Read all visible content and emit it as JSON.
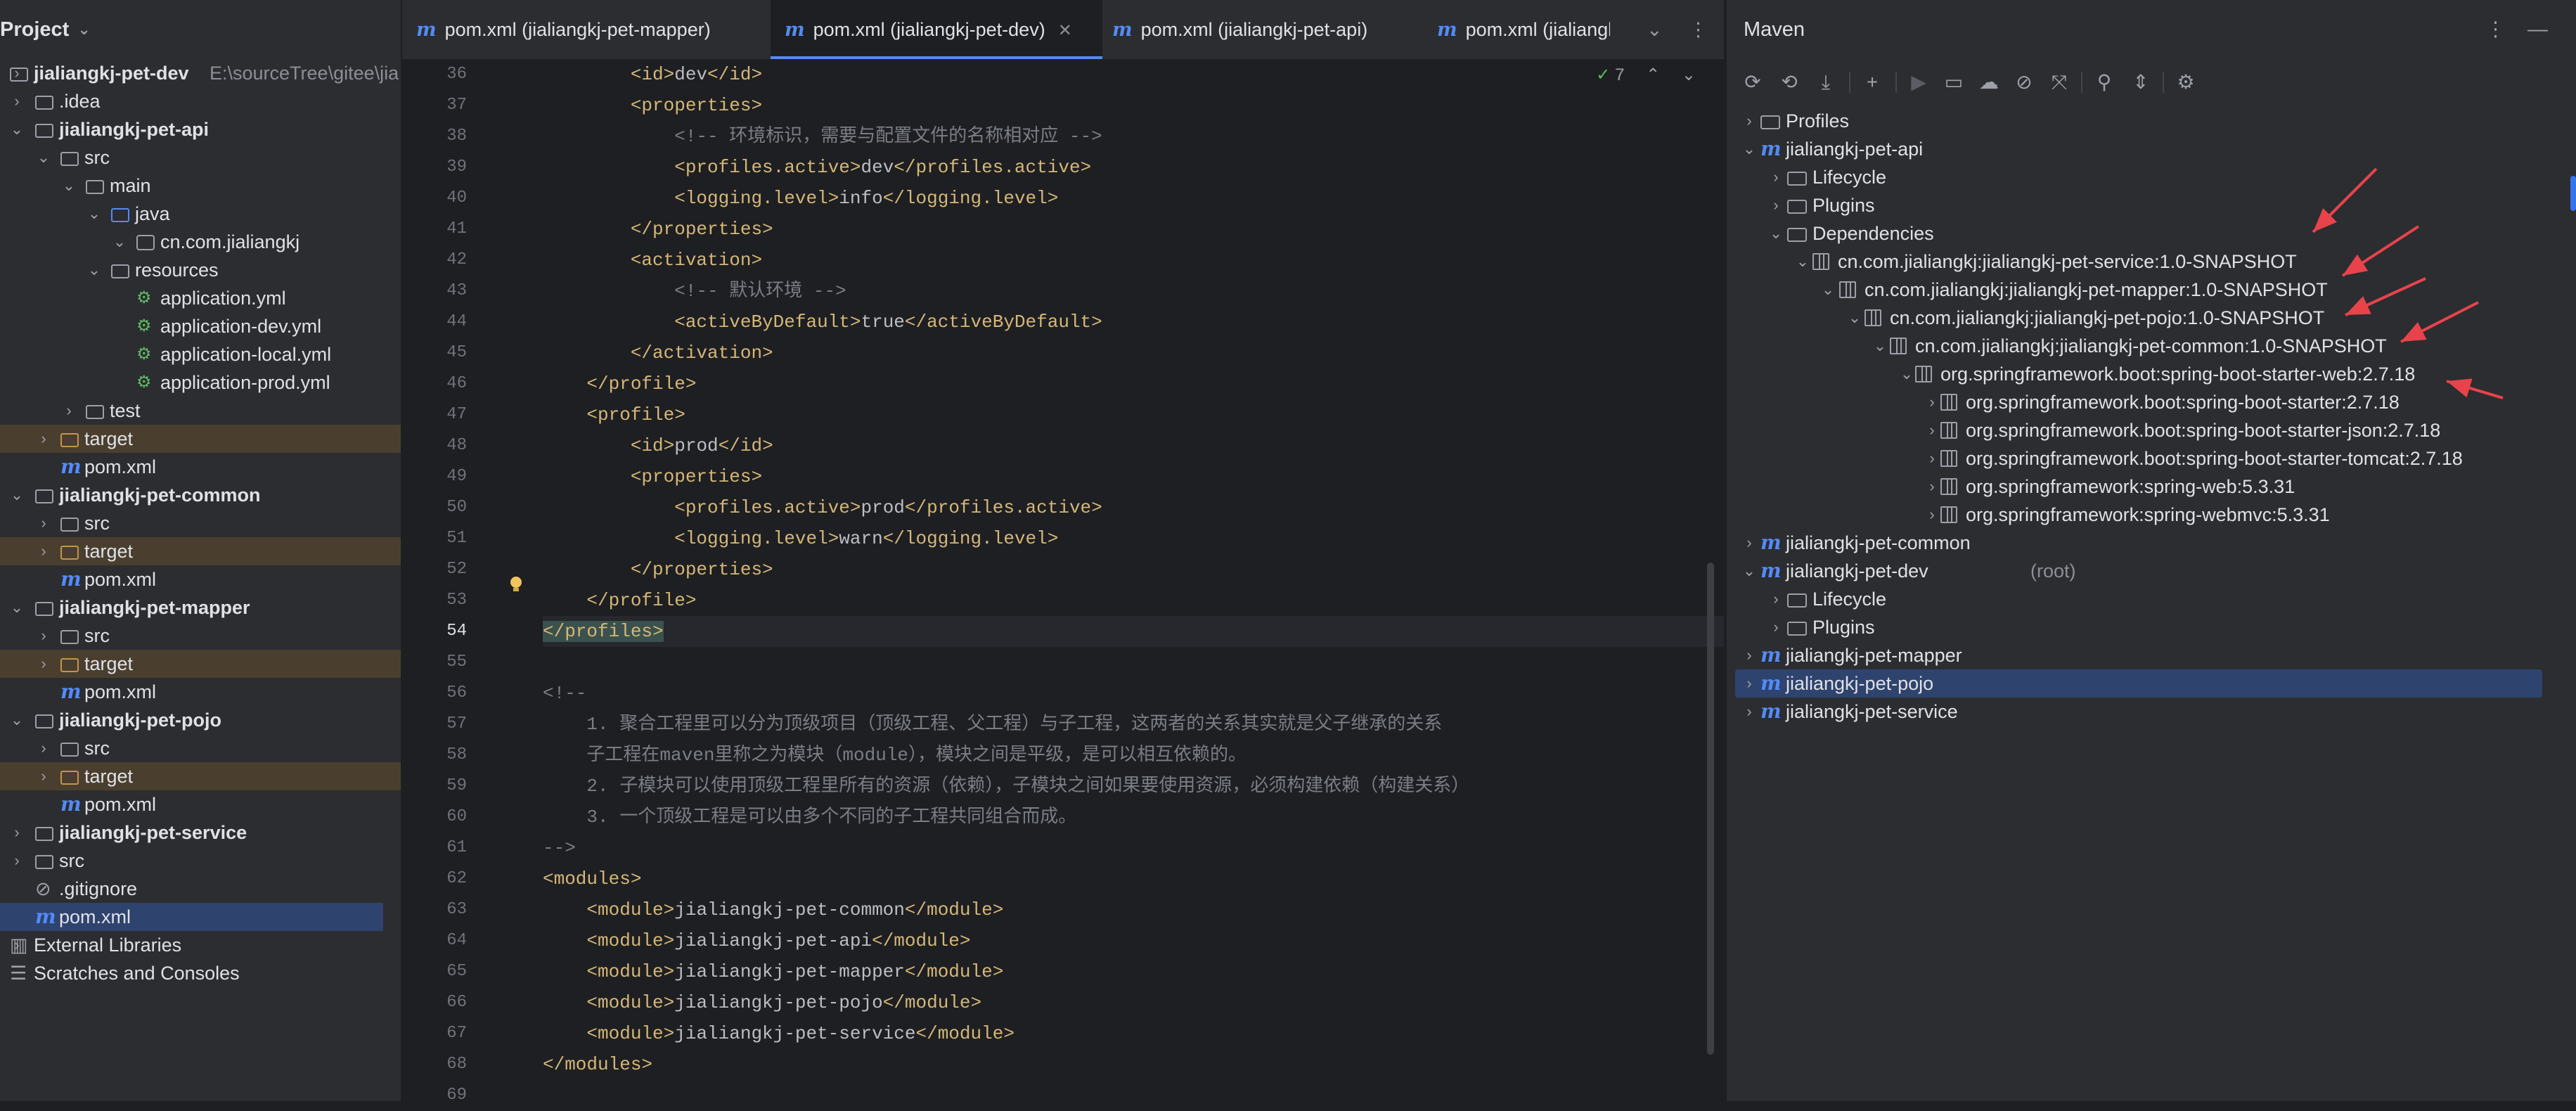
{
  "project": {
    "title": "Project",
    "items": [
      {
        "label": "jialiangkj-pet-dev",
        "path": "E:\\sourceTree\\gitee\\jia"
      },
      {
        "label": ".idea"
      },
      {
        "label": "jialiangkj-pet-api"
      },
      {
        "label": "src"
      },
      {
        "label": "main"
      },
      {
        "label": "java"
      },
      {
        "label": "cn.com.jialiangkj"
      },
      {
        "label": "resources"
      },
      {
        "label": "application.yml"
      },
      {
        "label": "application-dev.yml"
      },
      {
        "label": "application-local.yml"
      },
      {
        "label": "application-prod.yml"
      },
      {
        "label": "test"
      },
      {
        "label": "target"
      },
      {
        "label": "pom.xml"
      },
      {
        "label": "jialiangkj-pet-common"
      },
      {
        "label": "src"
      },
      {
        "label": "target"
      },
      {
        "label": "pom.xml"
      },
      {
        "label": "jialiangkj-pet-mapper"
      },
      {
        "label": "src"
      },
      {
        "label": "target"
      },
      {
        "label": "pom.xml"
      },
      {
        "label": "jialiangkj-pet-pojo"
      },
      {
        "label": "src"
      },
      {
        "label": "target"
      },
      {
        "label": "pom.xml"
      },
      {
        "label": "jialiangkj-pet-service"
      },
      {
        "label": "src"
      },
      {
        "label": ".gitignore"
      },
      {
        "label": "pom.xml"
      },
      {
        "label": "External Libraries"
      },
      {
        "label": "Scratches and Consoles"
      }
    ]
  },
  "editor": {
    "tabs": [
      {
        "label": "pom.xml (jialiangkj-pet-mapper)"
      },
      {
        "label": "pom.xml (jialiangkj-pet-dev)"
      },
      {
        "label": "pom.xml (jialiangkj-pet-api)"
      },
      {
        "label": "pom.xml (jialiangkj"
      }
    ],
    "inspection_count": "7",
    "lines": [
      {
        "n": "36",
        "segs": [
          [
            "t",
            "        <id>"
          ],
          [
            "tx",
            "dev"
          ],
          [
            "t",
            "</id>"
          ]
        ]
      },
      {
        "n": "37",
        "segs": [
          [
            "t",
            "        <properties>"
          ]
        ]
      },
      {
        "n": "38",
        "segs": [
          [
            "cm",
            "            <!-- 环境标识，需要与配置文件的名称相对应 -->"
          ]
        ]
      },
      {
        "n": "39",
        "segs": [
          [
            "t",
            "            <profiles.active>"
          ],
          [
            "tx",
            "dev"
          ],
          [
            "t",
            "</profiles.active>"
          ]
        ]
      },
      {
        "n": "40",
        "segs": [
          [
            "t",
            "            <logging.level>"
          ],
          [
            "tx",
            "info"
          ],
          [
            "t",
            "</logging.level>"
          ]
        ]
      },
      {
        "n": "41",
        "segs": [
          [
            "t",
            "        </properties>"
          ]
        ]
      },
      {
        "n": "42",
        "segs": [
          [
            "t",
            "        <activation>"
          ]
        ]
      },
      {
        "n": "43",
        "segs": [
          [
            "cm",
            "            <!-- 默认环境 -->"
          ]
        ]
      },
      {
        "n": "44",
        "segs": [
          [
            "t",
            "            <activeByDefault>"
          ],
          [
            "tx",
            "true"
          ],
          [
            "t",
            "</activeByDefault>"
          ]
        ]
      },
      {
        "n": "45",
        "segs": [
          [
            "t",
            "        </activation>"
          ]
        ]
      },
      {
        "n": "46",
        "segs": [
          [
            "t",
            "    </profile>"
          ]
        ]
      },
      {
        "n": "47",
        "segs": [
          [
            "t",
            "    <profile>"
          ]
        ]
      },
      {
        "n": "48",
        "segs": [
          [
            "t",
            "        <id>"
          ],
          [
            "tx",
            "prod"
          ],
          [
            "t",
            "</id>"
          ]
        ]
      },
      {
        "n": "49",
        "segs": [
          [
            "t",
            "        <properties>"
          ]
        ]
      },
      {
        "n": "50",
        "segs": [
          [
            "t",
            "            <profiles.active>"
          ],
          [
            "tx",
            "prod"
          ],
          [
            "t",
            "</profiles.active>"
          ]
        ]
      },
      {
        "n": "51",
        "segs": [
          [
            "t",
            "            <logging.level>"
          ],
          [
            "tx",
            "warn"
          ],
          [
            "t",
            "</logging.level>"
          ]
        ]
      },
      {
        "n": "52",
        "segs": [
          [
            "t",
            "        </properties>"
          ]
        ]
      },
      {
        "n": "53",
        "segs": [
          [
            "t",
            "    </profile>"
          ]
        ]
      },
      {
        "n": "54",
        "segs": [
          [
            "t",
            "</profiles>"
          ]
        ]
      },
      {
        "n": "55",
        "segs": []
      },
      {
        "n": "56",
        "segs": [
          [
            "cm",
            "<!--"
          ]
        ]
      },
      {
        "n": "57",
        "segs": [
          [
            "cm",
            "    1. 聚合工程里可以分为顶级项目（顶级工程、父工程）与子工程，这两者的关系其实就是父子继承的关系"
          ]
        ]
      },
      {
        "n": "58",
        "segs": [
          [
            "cm",
            "    子工程在maven里称之为模块（module），模块之间是平级，是可以相互依赖的。"
          ]
        ]
      },
      {
        "n": "59",
        "segs": [
          [
            "cm",
            "    2. 子模块可以使用顶级工程里所有的资源（依赖），子模块之间如果要使用资源，必须构建依赖（构建关系）"
          ]
        ]
      },
      {
        "n": "60",
        "segs": [
          [
            "cm",
            "    3. 一个顶级工程是可以由多个不同的子工程共同组合而成。"
          ]
        ]
      },
      {
        "n": "61",
        "segs": [
          [
            "cm",
            "-->"
          ]
        ]
      },
      {
        "n": "62",
        "segs": [
          [
            "t",
            "<modules>"
          ]
        ]
      },
      {
        "n": "63",
        "segs": [
          [
            "t",
            "    <module>"
          ],
          [
            "tx",
            "jialiangkj-pet-common"
          ],
          [
            "t",
            "</module>"
          ]
        ]
      },
      {
        "n": "64",
        "segs": [
          [
            "t",
            "    <module>"
          ],
          [
            "tx",
            "jialiangkj-pet-api"
          ],
          [
            "t",
            "</module>"
          ]
        ]
      },
      {
        "n": "65",
        "segs": [
          [
            "t",
            "    <module>"
          ],
          [
            "tx",
            "jialiangkj-pet-mapper"
          ],
          [
            "t",
            "</module>"
          ]
        ]
      },
      {
        "n": "66",
        "segs": [
          [
            "t",
            "    <module>"
          ],
          [
            "tx",
            "jialiangkj-pet-pojo"
          ],
          [
            "t",
            "</module>"
          ]
        ]
      },
      {
        "n": "67",
        "segs": [
          [
            "t",
            "    <module>"
          ],
          [
            "tx",
            "jialiangkj-pet-service"
          ],
          [
            "t",
            "</module>"
          ]
        ]
      },
      {
        "n": "68",
        "segs": [
          [
            "t",
            "</modules>"
          ]
        ]
      },
      {
        "n": "69",
        "segs": []
      }
    ]
  },
  "maven": {
    "title": "Maven",
    "items": [
      {
        "label": "Profiles"
      },
      {
        "label": "jialiangkj-pet-api"
      },
      {
        "label": "Lifecycle"
      },
      {
        "label": "Plugins"
      },
      {
        "label": "Dependencies"
      },
      {
        "label": "cn.com.jialiangkj:jialiangkj-pet-service:1.0-SNAPSHOT"
      },
      {
        "label": "cn.com.jialiangkj:jialiangkj-pet-mapper:1.0-SNAPSHOT"
      },
      {
        "label": "cn.com.jialiangkj:jialiangkj-pet-pojo:1.0-SNAPSHOT"
      },
      {
        "label": "cn.com.jialiangkj:jialiangkj-pet-common:1.0-SNAPSHOT"
      },
      {
        "label": "org.springframework.boot:spring-boot-starter-web:2.7.18"
      },
      {
        "label": "org.springframework.boot:spring-boot-starter:2.7.18"
      },
      {
        "label": "org.springframework.boot:spring-boot-starter-json:2.7.18"
      },
      {
        "label": "org.springframework.boot:spring-boot-starter-tomcat:2.7.18"
      },
      {
        "label": "org.springframework:spring-web:5.3.31"
      },
      {
        "label": "org.springframework:spring-webmvc:5.3.31"
      },
      {
        "label": "jialiangkj-pet-common"
      },
      {
        "label": "jialiangkj-pet-dev",
        "suffix": "(root)"
      },
      {
        "label": "Lifecycle"
      },
      {
        "label": "Plugins"
      },
      {
        "label": "jialiangkj-pet-mapper"
      },
      {
        "label": "jialiangkj-pet-pojo"
      },
      {
        "label": "jialiangkj-pet-service"
      }
    ]
  },
  "colors": {
    "accent": "#548af7",
    "selection": "#2e436e",
    "annotation_arrow": "#e8434b"
  }
}
